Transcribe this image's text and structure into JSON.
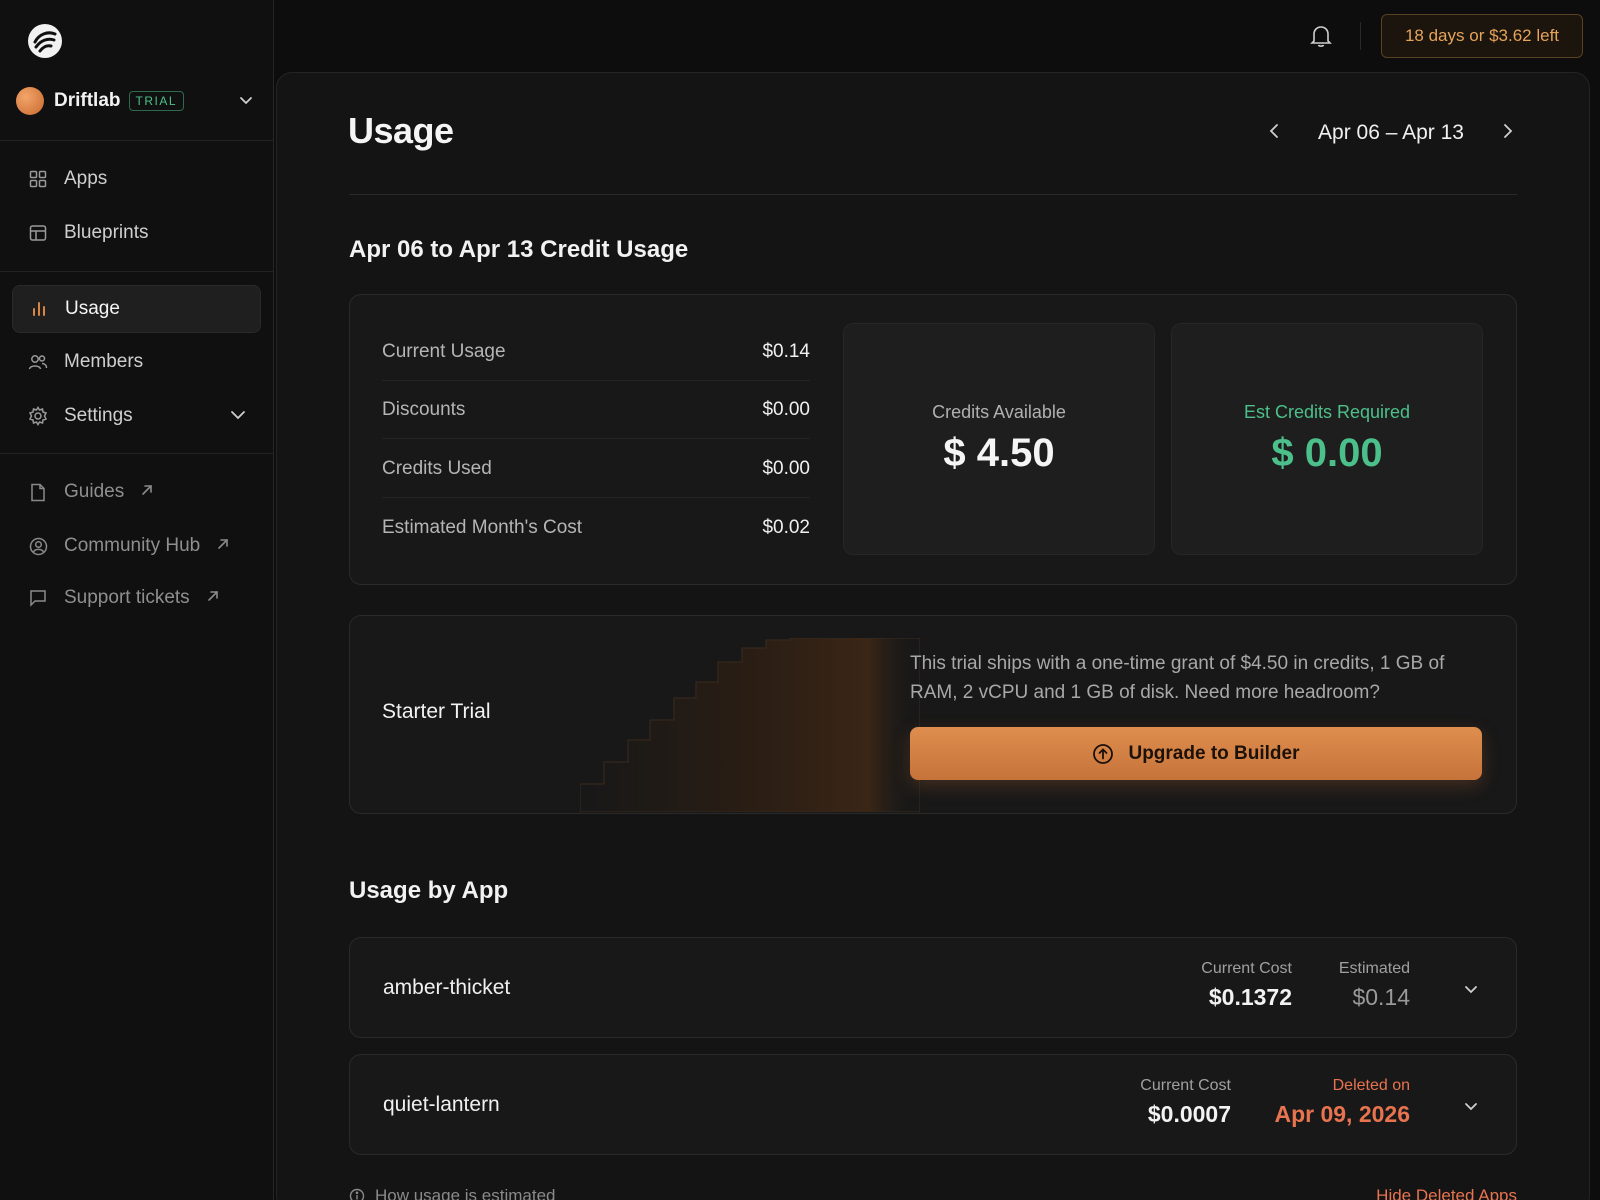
{
  "sidebar": {
    "logo": "driftlab-logo-icon",
    "workspace": {
      "name": "Driftlab",
      "badge": "TRIAL"
    },
    "items": [
      {
        "label": "Apps",
        "icon": "grid-icon"
      },
      {
        "label": "Blueprints",
        "icon": "blueprint-icon"
      },
      {
        "label": "Usage",
        "icon": "bar-chart-icon",
        "active": true
      },
      {
        "label": "Members",
        "icon": "users-icon"
      },
      {
        "label": "Settings",
        "icon": "gear-icon"
      }
    ],
    "links": [
      {
        "label": "Guides",
        "icon": "document-icon"
      },
      {
        "label": "Community Hub",
        "icon": "user-circle-icon"
      },
      {
        "label": "Support tickets",
        "icon": "chat-icon"
      }
    ]
  },
  "topbar": {
    "trial_status": "18 days or $3.62 left"
  },
  "page": {
    "title": "Usage",
    "date_range": "Apr 06 – Apr 13",
    "credit_section_title": "Apr 06 to Apr 13 Credit Usage",
    "stats": [
      {
        "label": "Current Usage",
        "value": "$0.14"
      },
      {
        "label": "Discounts",
        "value": "$0.00"
      },
      {
        "label": "Credits Used",
        "value": "$0.00"
      },
      {
        "label": "Estimated Month's Cost",
        "value": "$0.02"
      }
    ],
    "credits_available": {
      "label": "Credits Available",
      "value": "$ 4.50"
    },
    "est_credits_required": {
      "label": "Est Credits Required",
      "value": "$ 0.00"
    },
    "plan": {
      "name": "Starter Trial",
      "description": "This trial ships with a one-time grant of $4.50 in credits, 1 GB of RAM, 2 vCPU and 1 GB of disk. Need more headroom?",
      "upgrade_label": "Upgrade to Builder"
    },
    "apps_section_title": "Usage by App",
    "apps": [
      {
        "name": "amber-thicket",
        "current_cost_label": "Current Cost",
        "current_cost": "$0.1372",
        "secondary_label": "Estimated",
        "secondary_value": "$0.14"
      },
      {
        "name": "quiet-lantern",
        "current_cost_label": "Current Cost",
        "current_cost": "$0.0007",
        "secondary_label": "Deleted on",
        "secondary_value": "Apr 09, 2026"
      }
    ],
    "footer": {
      "help_link": "How usage is estimated",
      "toggle_deleted": "Hide Deleted Apps"
    }
  },
  "colors": {
    "accent": "#d98544",
    "success": "#4cc08a",
    "danger": "#e8734f",
    "background": "#0d0d0d"
  }
}
